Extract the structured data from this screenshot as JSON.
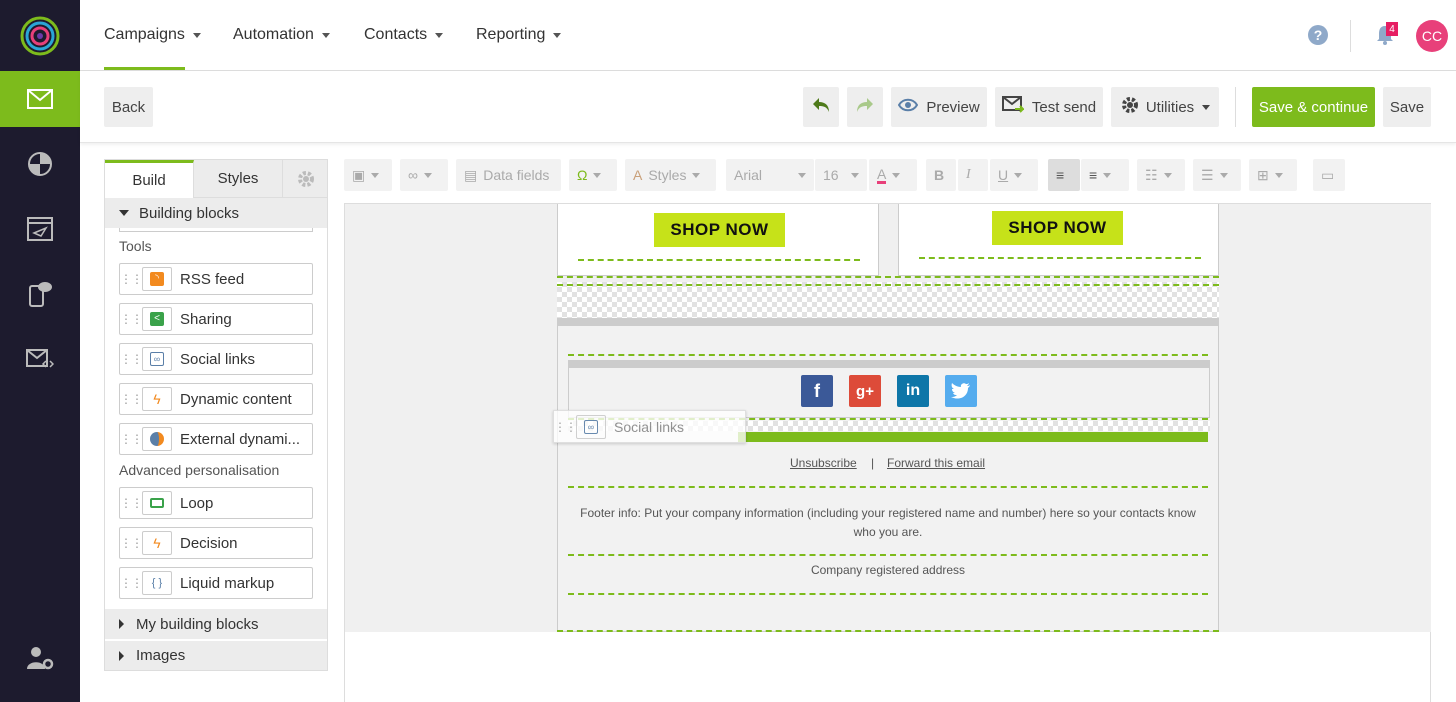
{
  "top_nav": {
    "menu": [
      {
        "label": "Campaigns",
        "active": true
      },
      {
        "label": "Automation"
      },
      {
        "label": "Contacts"
      },
      {
        "label": "Reporting"
      }
    ],
    "notifications_count": "4",
    "avatar_initials": "CC"
  },
  "toolbar": {
    "back": "Back",
    "preview": "Preview",
    "test_send": "Test send",
    "utilities": "Utilities",
    "save_continue": "Save & continue",
    "save": "Save"
  },
  "panel": {
    "tabs": {
      "build": "Build",
      "styles": "Styles"
    },
    "building_blocks": "Building blocks",
    "tools_label": "Tools",
    "tools": [
      "RSS feed",
      "Sharing",
      "Social links",
      "Dynamic content",
      "External dynami..."
    ],
    "advanced_label": "Advanced personalisation",
    "advanced": [
      "Loop",
      "Decision",
      "Liquid markup"
    ],
    "my_building_blocks": "My building blocks",
    "images": "Images"
  },
  "editor_tools": {
    "data_fields": "Data fields",
    "styles": "Styles",
    "font": "Arial",
    "size": "16"
  },
  "email": {
    "shop_now_1": "SHOP NOW",
    "shop_now_2": "SHOP NOW",
    "drag_label": "Social links",
    "unsubscribe": "Unsubscribe",
    "separator": "|",
    "forward": "Forward this email",
    "footer_info": "Footer info: Put your company information (including your registered name and number) here so your contacts know who you are.",
    "address": "Company registered address"
  },
  "colors": {
    "brand_green": "#7dbb1c",
    "sidebar_bg": "#1d1b2e",
    "shop_button": "#c6e219",
    "avatar_pink": "#e8407a"
  }
}
